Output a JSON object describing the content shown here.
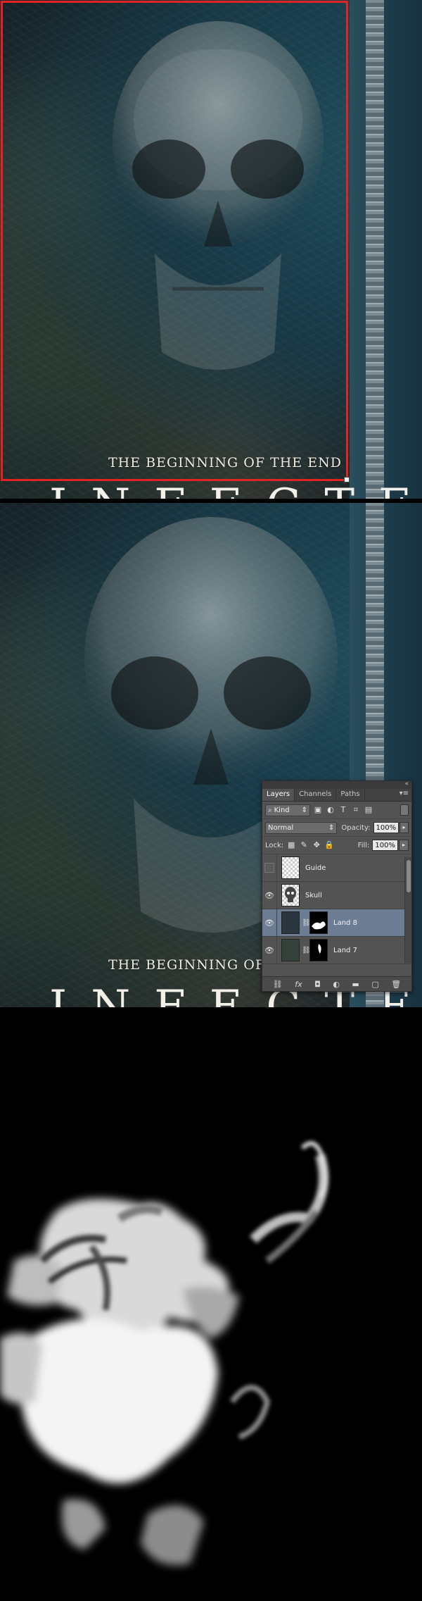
{
  "poster": {
    "tagline": "THE BEGINNING OF THE END",
    "tagline_cropped": "THE BEGINNING OF T",
    "title": "INFECTED",
    "selection_color": "#e32222"
  },
  "layers_panel": {
    "tabs": [
      {
        "label": "Layers",
        "active": true
      },
      {
        "label": "Channels",
        "active": false
      },
      {
        "label": "Paths",
        "active": false
      }
    ],
    "filter": {
      "kind_label": "Kind"
    },
    "blend_mode": "Normal",
    "opacity": {
      "label": "Opacity:",
      "value": "100%"
    },
    "lock_label": "Lock:",
    "fill": {
      "label": "Fill:",
      "value": "100%"
    },
    "layers": [
      {
        "name": "Guide",
        "visible": false,
        "selected": false,
        "has_mask": false
      },
      {
        "name": "Skull",
        "visible": true,
        "selected": false,
        "has_mask": false
      },
      {
        "name": "Land 8",
        "visible": true,
        "selected": true,
        "has_mask": true
      },
      {
        "name": "Land 7",
        "visible": true,
        "selected": false,
        "has_mask": true
      }
    ],
    "footer_icons": [
      "link-icon",
      "fx-icon",
      "mask-icon",
      "adjustment-icon",
      "folder-icon",
      "new-layer-icon",
      "trash-icon"
    ],
    "footer_fx_label": "fx"
  },
  "colors": {
    "panel_bg": "#535353",
    "selected_row": "#6c7d93",
    "mask_white": "#ffffff"
  }
}
